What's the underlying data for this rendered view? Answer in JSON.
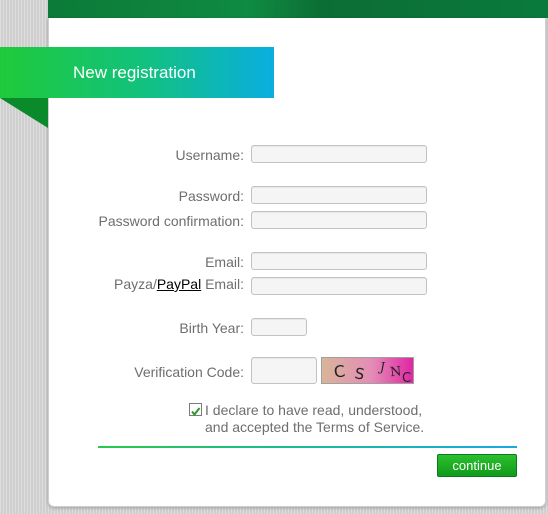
{
  "header": {
    "title": "New registration"
  },
  "form": {
    "username_label": "Username:",
    "username_value": "",
    "password_label": "Password:",
    "password_value": "",
    "password_confirm_label": "Password confirmation:",
    "password_confirm_value": "",
    "email_label": "Email:",
    "email_value": "",
    "payment_email_label_prefix": "Payza/",
    "payment_email_label_link": "PayPal",
    "payment_email_label_suffix": " Email:",
    "payment_email_value": "",
    "birth_year_label": "Birth Year:",
    "birth_year_value": "",
    "verification_label": "Verification Code:",
    "verification_value": "",
    "captcha_text": "CSJNC",
    "terms_checked": true,
    "terms_line1": "I declare to have read, understood,",
    "terms_line2": "and accepted the Terms of Service.",
    "continue_label": "continue"
  },
  "colors": {
    "accent_green": "#1fca3a",
    "accent_blue": "#0aaee0",
    "button_green": "#119a1c",
    "header_dark_green": "#0c7a38"
  }
}
